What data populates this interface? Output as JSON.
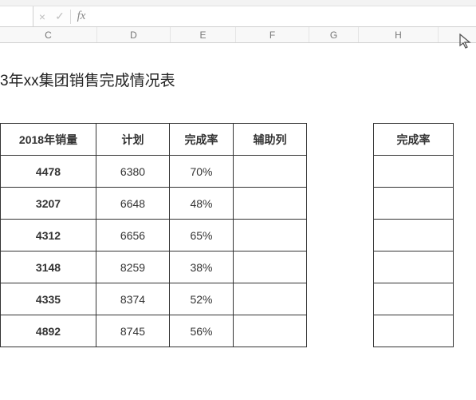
{
  "formulaBar": {
    "cancelGlyph": "×",
    "enterGlyph": "✓",
    "fxLabel": "fx"
  },
  "columns": [
    "C",
    "D",
    "E",
    "F",
    "G",
    "H"
  ],
  "title": "3年xx集团销售完成情况表",
  "tableHeaders": {
    "salesYear": "2018年销量",
    "plan": "计划",
    "rate": "完成率",
    "aux": "辅助列"
  },
  "rows": [
    {
      "sales": "4478",
      "plan": "6380",
      "rate": "70%",
      "aux": ""
    },
    {
      "sales": "3207",
      "plan": "6648",
      "rate": "48%",
      "aux": ""
    },
    {
      "sales": "4312",
      "plan": "6656",
      "rate": "65%",
      "aux": ""
    },
    {
      "sales": "3148",
      "plan": "8259",
      "rate": "38%",
      "aux": ""
    },
    {
      "sales": "4335",
      "plan": "8374",
      "rate": "52%",
      "aux": ""
    },
    {
      "sales": "4892",
      "plan": "8745",
      "rate": "56%",
      "aux": ""
    }
  ],
  "sideHeader": "完成率",
  "chart_data": {
    "type": "table",
    "title": "3年xx集团销售完成情况表",
    "columns": [
      "2018年销量",
      "计划",
      "完成率",
      "辅助列"
    ],
    "rows": [
      [
        4478,
        6380,
        0.7,
        null
      ],
      [
        3207,
        6648,
        0.48,
        null
      ],
      [
        4312,
        6656,
        0.65,
        null
      ],
      [
        3148,
        8259,
        0.38,
        null
      ],
      [
        4335,
        8374,
        0.52,
        null
      ],
      [
        4892,
        8745,
        0.56,
        null
      ]
    ]
  }
}
